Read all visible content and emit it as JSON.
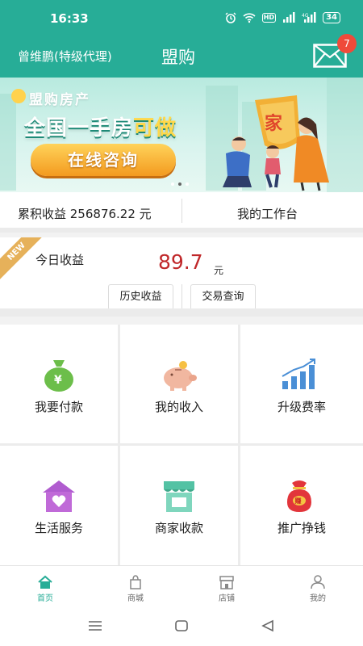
{
  "status_bar": {
    "time": "16:33",
    "hd": "HD",
    "battery": "34"
  },
  "header": {
    "user": "曾维鹏(特级代理)",
    "title": "盟购",
    "unread_count": "7"
  },
  "banner": {
    "brand": "盟购房产",
    "headline_a": "全国一手房",
    "headline_b": "可做",
    "cta": "在线咨询",
    "family_sign": "家"
  },
  "earnings": {
    "total_label": "累积收益 256876.22 元",
    "workbench": "我的工作台"
  },
  "today": {
    "ribbon": "NEW",
    "label": "今日收益",
    "amount": "89.7",
    "unit": "元",
    "history_button": "历史收益",
    "transactions_button": "交易查询"
  },
  "grid": [
    {
      "label": "我要付款",
      "icon": "money-bag-icon"
    },
    {
      "label": "我的收入",
      "icon": "piggy-bank-icon"
    },
    {
      "label": "升级费率",
      "icon": "bar-chart-icon"
    },
    {
      "label": "生活服务",
      "icon": "house-heart-icon"
    },
    {
      "label": "商家收款",
      "icon": "storefront-icon"
    },
    {
      "label": "推广挣钱",
      "icon": "lucky-bag-icon"
    }
  ],
  "tabs": [
    {
      "label": "首页",
      "icon": "home-icon",
      "active": true
    },
    {
      "label": "商城",
      "icon": "shopping-bag-icon",
      "active": false
    },
    {
      "label": "店铺",
      "icon": "shop-icon",
      "active": false
    },
    {
      "label": "我的",
      "icon": "user-icon",
      "active": false
    }
  ],
  "colors": {
    "primary": "#27ad97",
    "amount": "#c0282a",
    "badge": "#ef4a3a",
    "cta": "#f39a1f"
  }
}
